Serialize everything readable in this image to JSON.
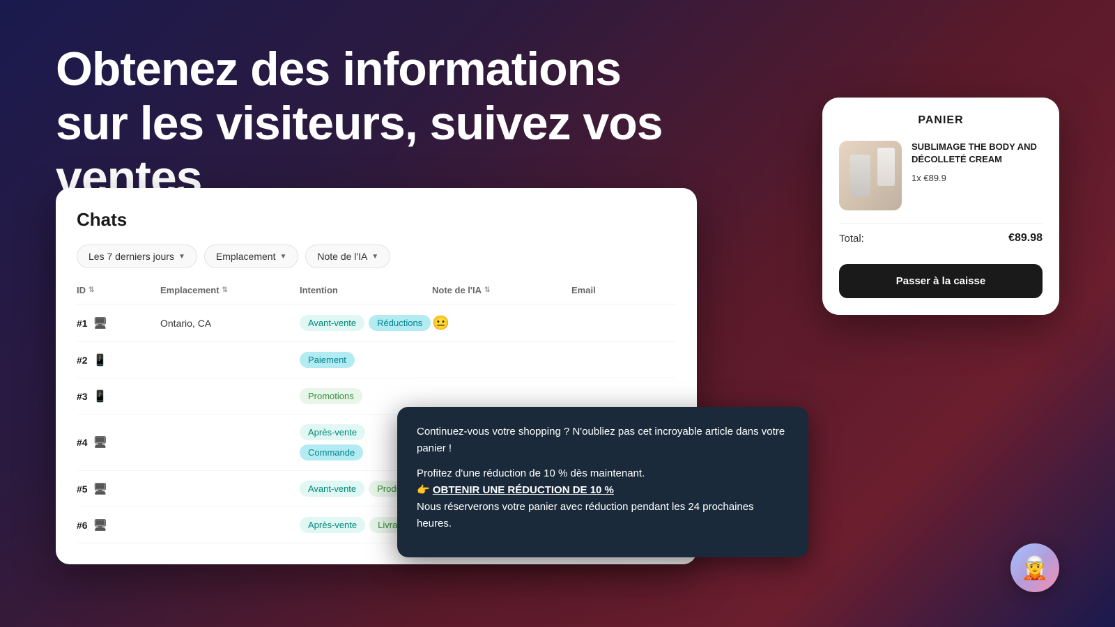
{
  "hero": {
    "title": "Obtenez des informations sur les visiteurs, suivez vos ventes"
  },
  "chat_panel": {
    "title": "Chats",
    "filters": [
      {
        "label": "Les 7 derniers jours",
        "has_chevron": true
      },
      {
        "label": "Emplacement",
        "has_chevron": true
      },
      {
        "label": "Note de l'IA",
        "has_chevron": true
      }
    ],
    "columns": [
      "ID",
      "Emplacement",
      "Intention",
      "Note de l'IA",
      "Email"
    ],
    "rows": [
      {
        "id": "#1",
        "device": "desktop",
        "location": "Ontario, CA",
        "tags": [
          "Avant-vente",
          "Réductions"
        ],
        "ai_note": "😐",
        "email": ""
      },
      {
        "id": "#2",
        "device": "mobile",
        "location": "",
        "tags": [
          "Paiement"
        ],
        "ai_note": "",
        "email": ""
      },
      {
        "id": "#3",
        "device": "mobile",
        "location": "",
        "tags": [
          "Promotions"
        ],
        "ai_note": "",
        "email": ""
      },
      {
        "id": "#4",
        "device": "desktop",
        "location": "",
        "tags": [
          "Après-vente",
          "Commande"
        ],
        "ai_note": "",
        "email": ""
      },
      {
        "id": "#5",
        "device": "desktop",
        "location": "",
        "tags": [
          "Avant-vente",
          "Produit"
        ],
        "ai_note": "",
        "email": ""
      },
      {
        "id": "#6",
        "device": "desktop",
        "location": "",
        "tags": [
          "Après-vente",
          "Livraison"
        ],
        "ai_note": "",
        "email": ""
      }
    ]
  },
  "cart_panel": {
    "title": "PANIER",
    "item": {
      "name": "SUBLIMAGE THE BODY AND DÉCOLLETÉ CREAM",
      "quantity": "1x",
      "price": "€89.9"
    },
    "total_label": "Total:",
    "total_value": "€89.98",
    "checkout_label": "Passer à la caisse"
  },
  "tooltip": {
    "line1": "Continuez-vous votre shopping ? N'oubliez pas cet incroyable article dans votre panier !",
    "line2": "Profitez d'une réduction de 10 % dès maintenant.",
    "link_icon": "👉",
    "link_text": "OBTENIR UNE RÉDUCTION DE 10 %",
    "line3": "Nous réserverons votre panier avec réduction pendant les 24 prochaines heures."
  }
}
